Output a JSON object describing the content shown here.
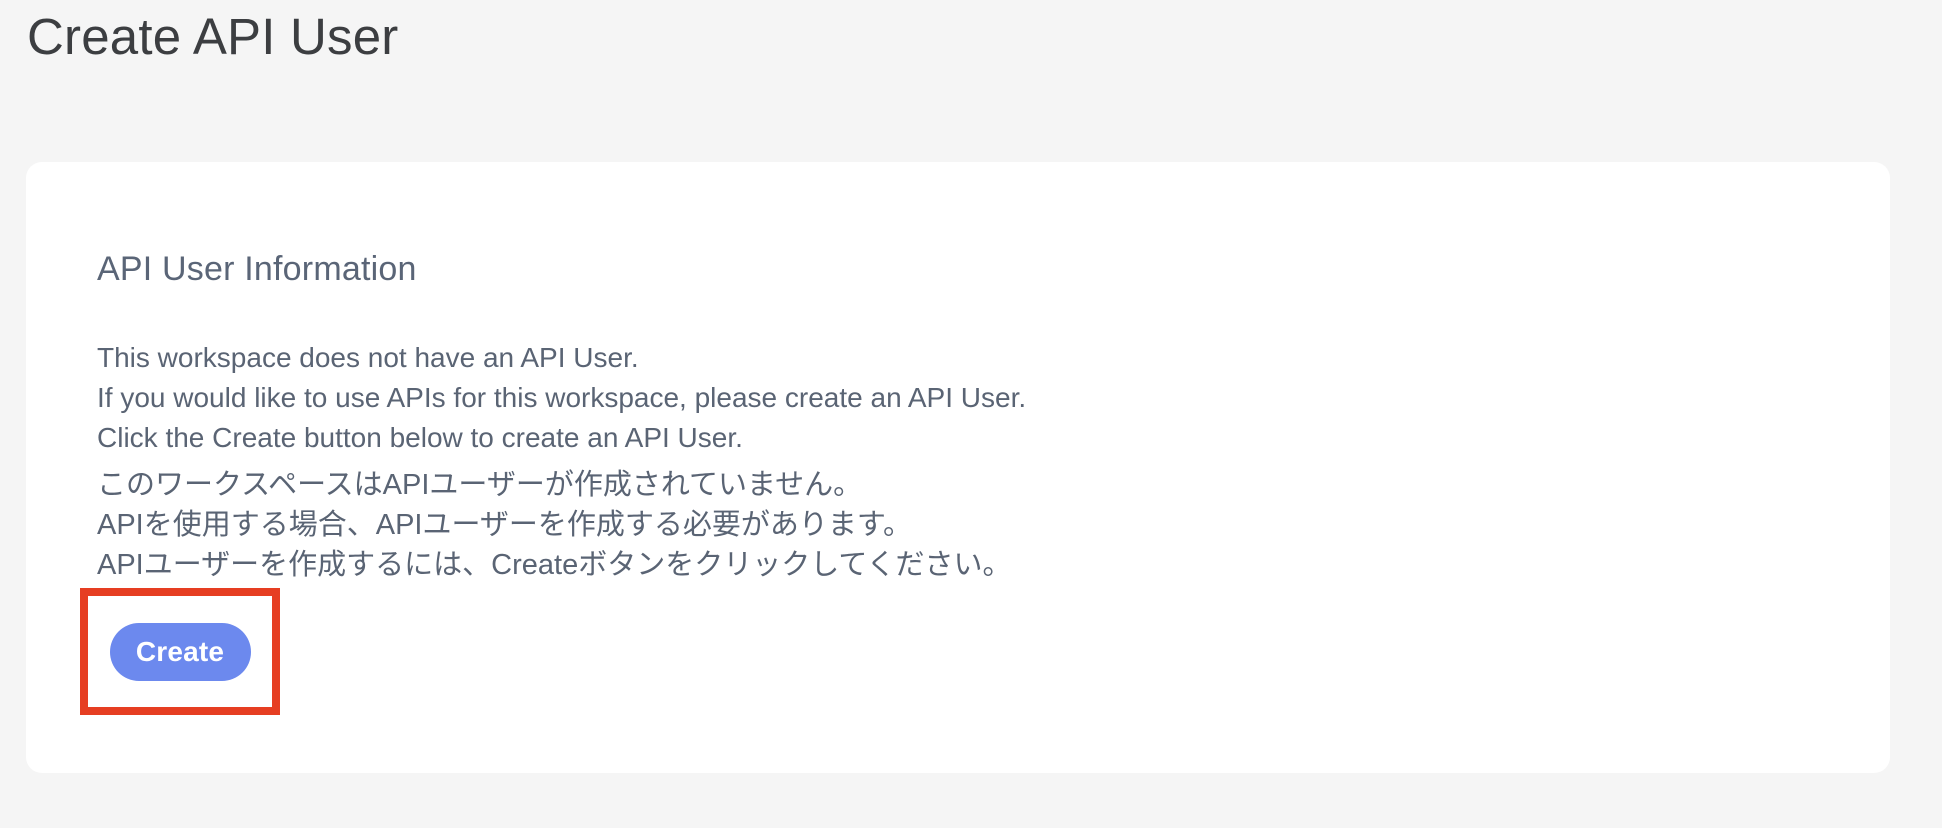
{
  "page": {
    "title": "Create API User"
  },
  "card": {
    "heading": "API User Information",
    "message_en": {
      "line1": "This workspace does not have an API User.",
      "line2": "If you would like to use APIs for this workspace, please create an API User.",
      "line3": "Click the Create button below to create an API User."
    },
    "message_ja": {
      "line1": "このワークスペースはAPIユーザーが作成されていません。",
      "line2": "APIを使用する場合、APIユーザーを作成する必要があります。",
      "line3": "APIユーザーを作成するには、Createボタンをクリックしてください。"
    },
    "create_button": {
      "label": "Create"
    }
  },
  "annotation": {
    "type": "highlight-rectangle",
    "target": "create-button"
  },
  "colors": {
    "background": "#f5f5f5",
    "card_background": "#ffffff",
    "title_text": "#3c3e41",
    "heading_text": "#5a6577",
    "body_text": "#5a6474",
    "button_background": "#6c89ee",
    "button_text": "#ffffff",
    "annotation_red": "#e63e22"
  }
}
